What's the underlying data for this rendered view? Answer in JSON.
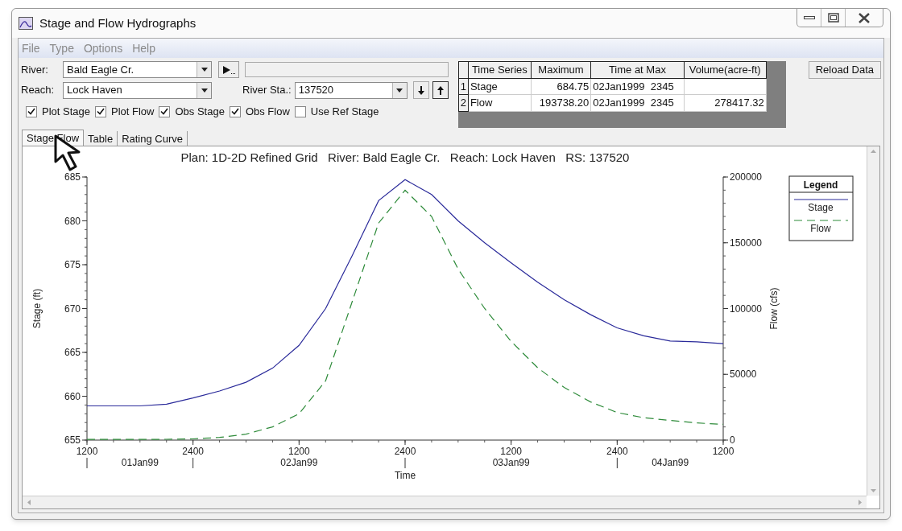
{
  "window": {
    "title": "Stage and Flow Hydrographs"
  },
  "menu": [
    "File",
    "Type",
    "Options",
    "Help"
  ],
  "river": {
    "label": "River:",
    "value": "Bald Eagle Cr."
  },
  "reach": {
    "label": "Reach:",
    "value": "Lock Haven"
  },
  "river_sta": {
    "label": "River Sta.:",
    "value": "137520"
  },
  "checkboxes": [
    {
      "label": "Plot Stage",
      "checked": true
    },
    {
      "label": "Plot Flow",
      "checked": true
    },
    {
      "label": "Obs Stage",
      "checked": true
    },
    {
      "label": "Obs Flow",
      "checked": true
    },
    {
      "label": "Use Ref Stage",
      "checked": false
    }
  ],
  "table": {
    "columns": [
      "Time Series",
      "Maximum",
      "Time at Max",
      "Volume(acre-ft)"
    ],
    "rows": [
      {
        "index": "1",
        "cells": [
          "Stage",
          "684.75",
          "02Jan1999  2345",
          ""
        ]
      },
      {
        "index": "2",
        "cells": [
          "Flow",
          "193738.20",
          "02Jan1999  2345",
          "278417.32"
        ]
      }
    ]
  },
  "reload_button": "Reload Data",
  "tabs": [
    {
      "label": "Stage Flow",
      "selected": true
    },
    {
      "label": "Table",
      "selected": false
    },
    {
      "label": "Rating Curve",
      "selected": false
    }
  ],
  "chart_data": {
    "type": "line",
    "title": "Plan: 1D-2D Refined Grid   River: Bald Eagle Cr.   Reach: Lock Haven   RS: 137520",
    "xlabel": "Time",
    "ylabel": "Stage (ft)",
    "y2label": "Flow (cfs)",
    "categories": [
      "1200",
      null,
      null,
      null,
      "2400",
      null,
      null,
      null,
      "1200",
      null,
      null,
      null,
      "2400",
      null,
      null,
      null,
      "1200",
      null,
      null,
      null,
      "2400",
      null,
      null,
      null,
      "1200"
    ],
    "annotations": [
      "01Jan99",
      "02Jan99",
      "03Jan99",
      "04Jan99"
    ],
    "ylim": [
      655,
      685
    ],
    "y2lim": [
      0,
      200000
    ],
    "yticks": [
      655,
      660,
      665,
      670,
      675,
      680,
      685
    ],
    "y2ticks": [
      0,
      50000,
      100000,
      150000,
      200000
    ],
    "legend_title": "Legend",
    "series": [
      {
        "name": "Stage",
        "color": "#2a2a9a",
        "line_style": "solid",
        "values": [
          658.9,
          658.9,
          658.9,
          659.1,
          659.8,
          660.6,
          661.6,
          663.2,
          665.8,
          670.0,
          676.0,
          682.3,
          684.7,
          683.0,
          680.0,
          677.5,
          675.2,
          673.0,
          671.0,
          669.3,
          667.8,
          666.9,
          666.3,
          666.2,
          666.0
        ]
      },
      {
        "name": "Flow",
        "color": "#2e8b3a",
        "axis": "y2",
        "line_style": "dashed",
        "values": [
          500,
          500,
          500,
          600,
          900,
          2000,
          4500,
          10000,
          20000,
          45000,
          105000,
          165000,
          190000,
          170000,
          130000,
          100000,
          75000,
          55000,
          40000,
          29000,
          21000,
          17000,
          15000,
          13000,
          12000
        ]
      }
    ]
  }
}
